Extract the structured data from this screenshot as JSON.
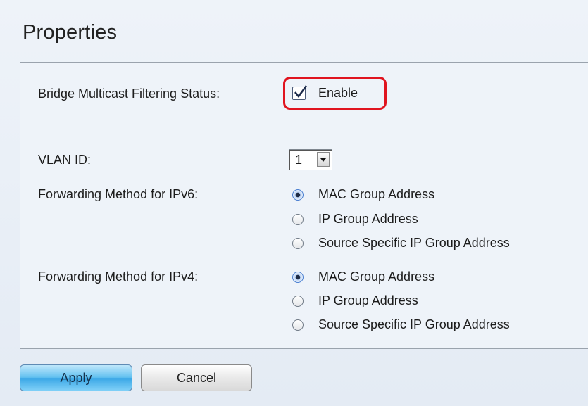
{
  "page": {
    "title": "Properties"
  },
  "bridge_multicast": {
    "label": "Bridge Multicast Filtering Status:",
    "checkbox_label": "Enable",
    "checked": true
  },
  "vlan": {
    "label": "VLAN ID:",
    "selected": "1"
  },
  "ipv6": {
    "label": "Forwarding Method for IPv6:",
    "options": [
      "MAC Group Address",
      "IP Group Address",
      "Source Specific IP Group Address"
    ],
    "selected_index": 0
  },
  "ipv4": {
    "label": "Forwarding Method for IPv4:",
    "options": [
      "MAC Group Address",
      "IP Group Address",
      "Source Specific IP Group Address"
    ],
    "selected_index": 0
  },
  "buttons": {
    "apply": "Apply",
    "cancel": "Cancel"
  },
  "colors": {
    "highlight": "#e0141f",
    "apply_button": "#3aa7e6"
  }
}
